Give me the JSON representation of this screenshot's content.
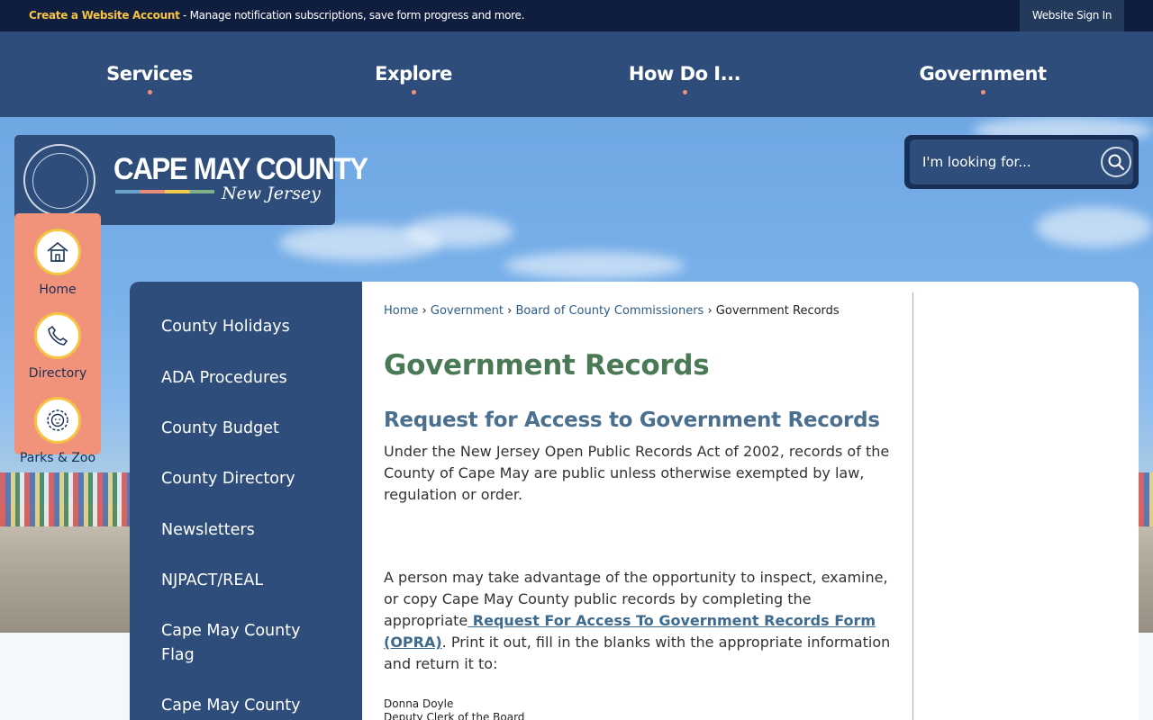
{
  "topbar": {
    "account_link": "Create a Website Account",
    "account_text": " - Manage notification subscriptions, save form progress and more.",
    "signin": "Website Sign In"
  },
  "nav": {
    "items": [
      {
        "label": "Services"
      },
      {
        "label": "Explore"
      },
      {
        "label": "How Do I..."
      },
      {
        "label": "Government"
      }
    ]
  },
  "logo": {
    "name": "CAPE MAY COUNTY",
    "state": "New Jersey"
  },
  "search": {
    "placeholder": "I'm looking for..."
  },
  "quick_links": [
    {
      "label": "Home",
      "icon": "house-icon"
    },
    {
      "label": "Directory",
      "icon": "phone-icon"
    },
    {
      "label": "Parks & Zoo",
      "icon": "lion-icon"
    }
  ],
  "sidenav": {
    "items": [
      "County Holidays",
      "ADA Procedures",
      "County Budget",
      "County Directory",
      "Newsletters",
      "NJPACT/REAL",
      "Cape May County Flag",
      "Cape May County"
    ]
  },
  "breadcrumb": {
    "items": [
      "Home",
      "Government",
      "Board of County Commissioners"
    ],
    "current": "Government Records",
    "separator": "›"
  },
  "page": {
    "title": "Government Records",
    "subtitle": "Request for Access to Government Records",
    "para1": "Under the New Jersey Open Public Records Act of 2002, records of the County of Cape May are public unless otherwise exempted by law, regulation or order.",
    "para2_before": "A person may take advantage of the opportunity to inspect, examine, or copy Cape May County public records by completing the appropriate",
    "para2_link": " Request For Access To Government Records Form (OPRA)",
    "para2_after": ". Print it out, fill in the blanks with the appropriate information and return it to:",
    "contact_name": "Donna Doyle",
    "contact_title": "Deputy Clerk of the Board"
  },
  "colors": {
    "topbar": "#0f1d3f",
    "nav": "#2e4d7a",
    "accent": "#f0937a",
    "title_green": "#4a7a55",
    "subtitle_blue": "#4a6f8f"
  }
}
